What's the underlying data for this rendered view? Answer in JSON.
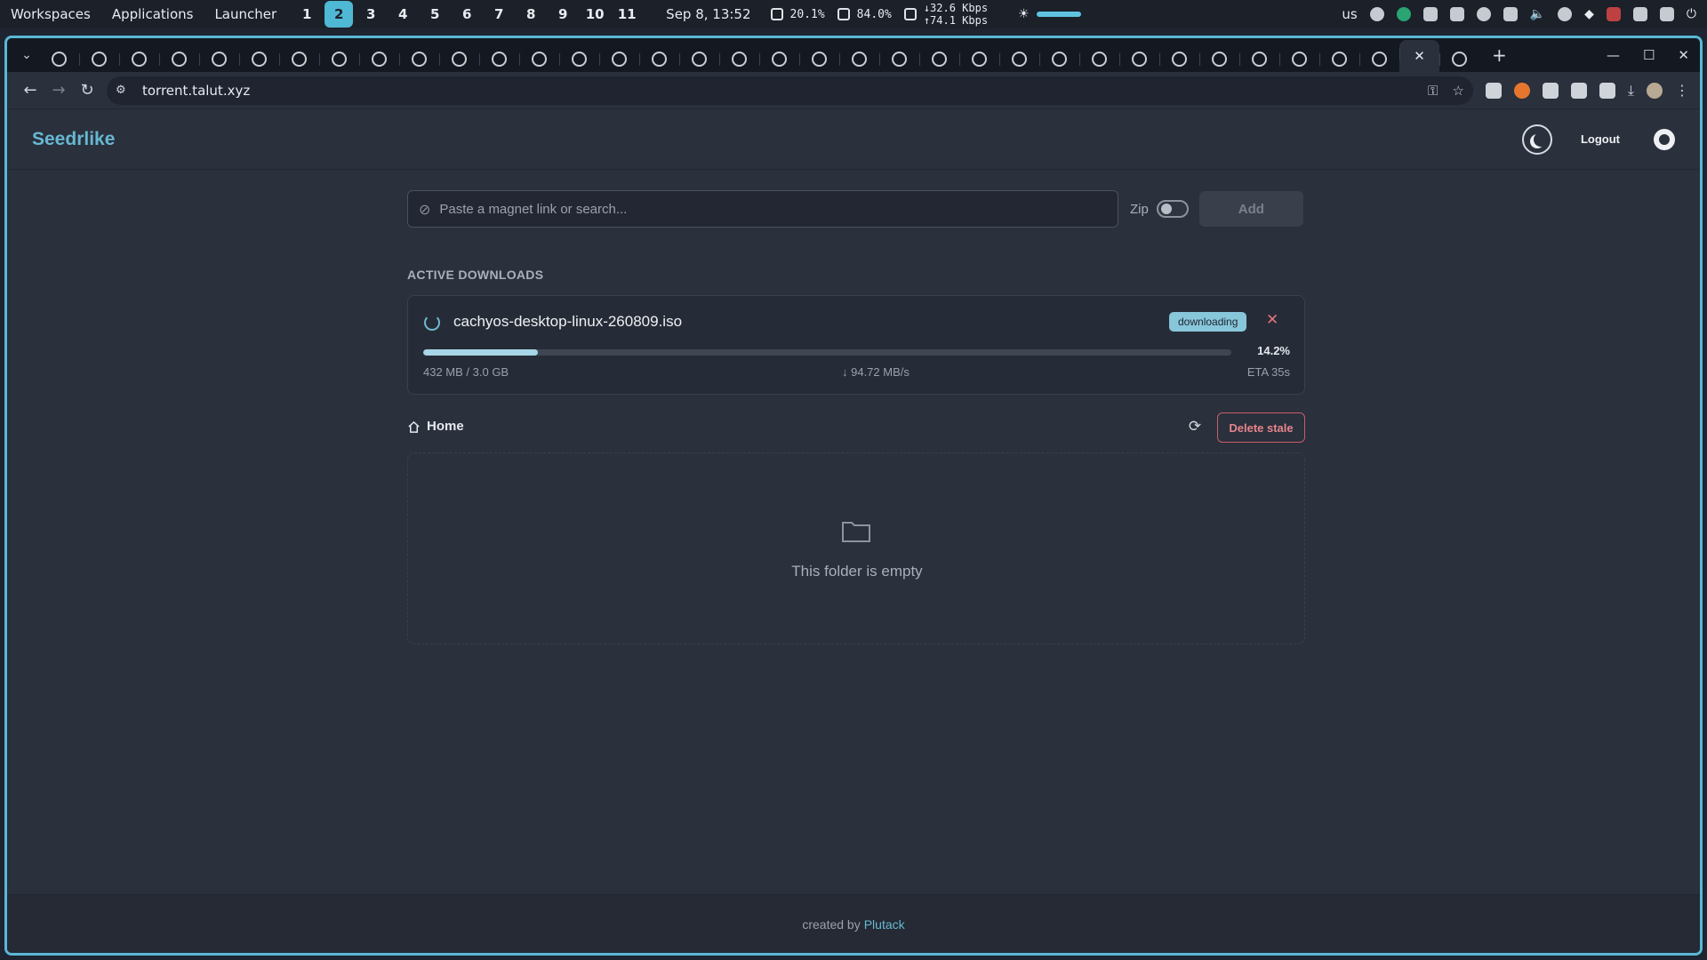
{
  "os_bar": {
    "menus": [
      "Workspaces",
      "Applications",
      "Launcher"
    ],
    "workspaces": [
      "1",
      "2",
      "3",
      "4",
      "5",
      "6",
      "7",
      "8",
      "9",
      "10",
      "11"
    ],
    "active_workspace": "2",
    "datetime": "Sep 8, 13:52",
    "cpu": "20.1%",
    "mem": "84.0%",
    "net_down": "↓32.6 Kbps",
    "net_up": "↑74.1 Kbps",
    "keyboard": "us"
  },
  "browser": {
    "tab_count": 36,
    "active_tab_close": "✕",
    "new_tab": "+",
    "window_controls": {
      "minimize": "—",
      "maximize": "☐",
      "close": "✕"
    },
    "url": "torrent.talut.xyz",
    "nav": {
      "back": "←",
      "forward": "→",
      "reload": "↻"
    }
  },
  "header": {
    "brand": "Seedrlike",
    "logout_label": "Logout",
    "icons": [
      "moon-icon",
      "github-icon"
    ]
  },
  "search": {
    "placeholder": "Paste a magnet link or search...",
    "zip_label": "Zip",
    "zip_enabled": false,
    "add_label": "Add"
  },
  "active_downloads": {
    "title": "ACTIVE DOWNLOADS",
    "items": [
      {
        "name": "cachyos-desktop-linux-260809.iso",
        "status": "downloading",
        "progress_pct": 14.2,
        "progress_label": "14.2%",
        "size": "432 MB / 3.0 GB",
        "speed": "↓ 94.72 MB/s",
        "eta": "ETA 35s"
      }
    ]
  },
  "files": {
    "breadcrumb": "Home",
    "delete_stale_label": "Delete stale",
    "empty_text": "This folder is empty"
  },
  "footer": {
    "prefix": "created by",
    "author": "Plutack"
  },
  "colors": {
    "accent": "#67b8d2",
    "badge": "#88c6da",
    "danger": "#c95e66",
    "page_bg": "#2a303c"
  }
}
